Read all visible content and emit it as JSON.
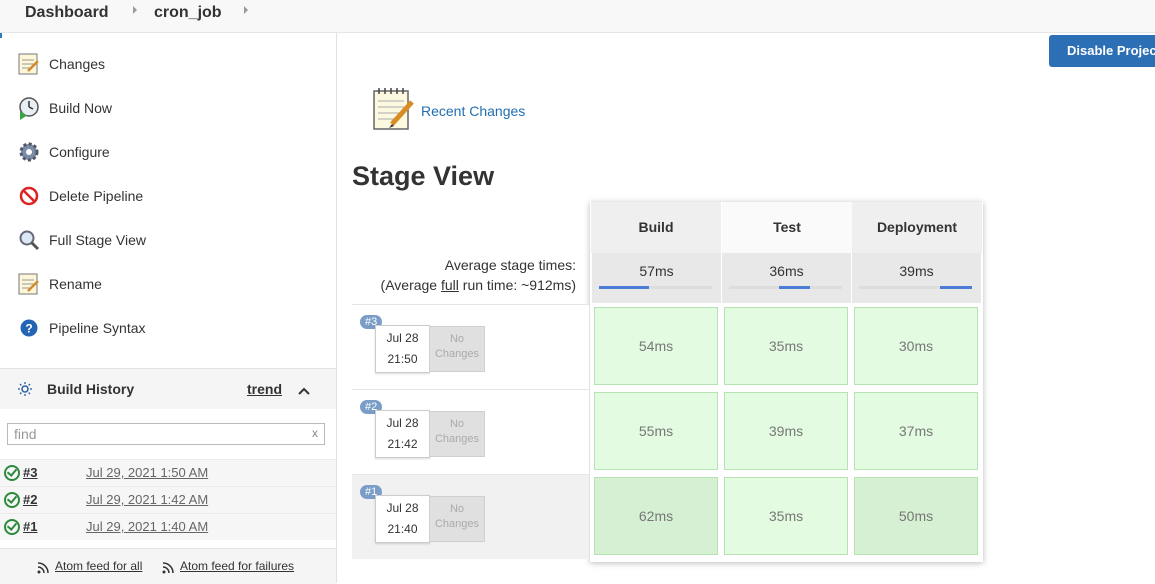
{
  "breadcrumb": {
    "items": [
      "Dashboard",
      "cron_job"
    ]
  },
  "sidebar": {
    "tasks": [
      {
        "label": "Changes",
        "icon": "notepad-icon"
      },
      {
        "label": "Build Now",
        "icon": "clock-play-icon"
      },
      {
        "label": "Configure",
        "icon": "gear-icon"
      },
      {
        "label": "Delete Pipeline",
        "icon": "no-entry-icon"
      },
      {
        "label": "Full Stage View",
        "icon": "magnifier-icon"
      },
      {
        "label": "Rename",
        "icon": "notepad-icon"
      },
      {
        "label": "Pipeline Syntax",
        "icon": "help-icon"
      }
    ],
    "build_history": {
      "title": "Build History",
      "trend": "trend",
      "find_placeholder": "find",
      "clear": "x",
      "builds": [
        {
          "number": "#3",
          "date": "Jul 29, 2021 1:50 AM",
          "status": "success"
        },
        {
          "number": "#2",
          "date": "Jul 29, 2021 1:42 AM",
          "status": "success"
        },
        {
          "number": "#1",
          "date": "Jul 29, 2021 1:40 AM",
          "status": "success"
        }
      ],
      "feeds": {
        "all": "Atom feed for all",
        "failures": "Atom feed for failures"
      }
    }
  },
  "main": {
    "disable_button": "Disable Project",
    "recent_changes": "Recent Changes",
    "stage_view_title": "Stage View",
    "avg_label_line1": "Average stage times:",
    "avg_label_prefix": "(Average ",
    "avg_label_full": "full",
    "avg_label_suffix": " run time: ~912ms)",
    "stages": [
      {
        "name": "Build",
        "avg": "57ms",
        "avg_bar_from": 0.0,
        "avg_bar_to": 0.44
      },
      {
        "name": "Test",
        "avg": "36ms",
        "avg_bar_from": 0.44,
        "avg_bar_to": 0.72
      },
      {
        "name": "Deployment",
        "avg": "39ms",
        "avg_bar_from": 0.72,
        "avg_bar_to": 1.0
      }
    ],
    "runs": [
      {
        "badge": "#3",
        "date": "Jul 28",
        "time": "21:50",
        "changes": "No Changes",
        "durations": [
          "54ms",
          "35ms",
          "30ms"
        ]
      },
      {
        "badge": "#2",
        "date": "Jul 28",
        "time": "21:42",
        "changes": "No Changes",
        "durations": [
          "55ms",
          "39ms",
          "37ms"
        ]
      },
      {
        "badge": "#1",
        "date": "Jul 28",
        "time": "21:40",
        "changes": "No Changes",
        "durations": [
          "62ms",
          "35ms",
          "50ms"
        ]
      }
    ]
  }
}
